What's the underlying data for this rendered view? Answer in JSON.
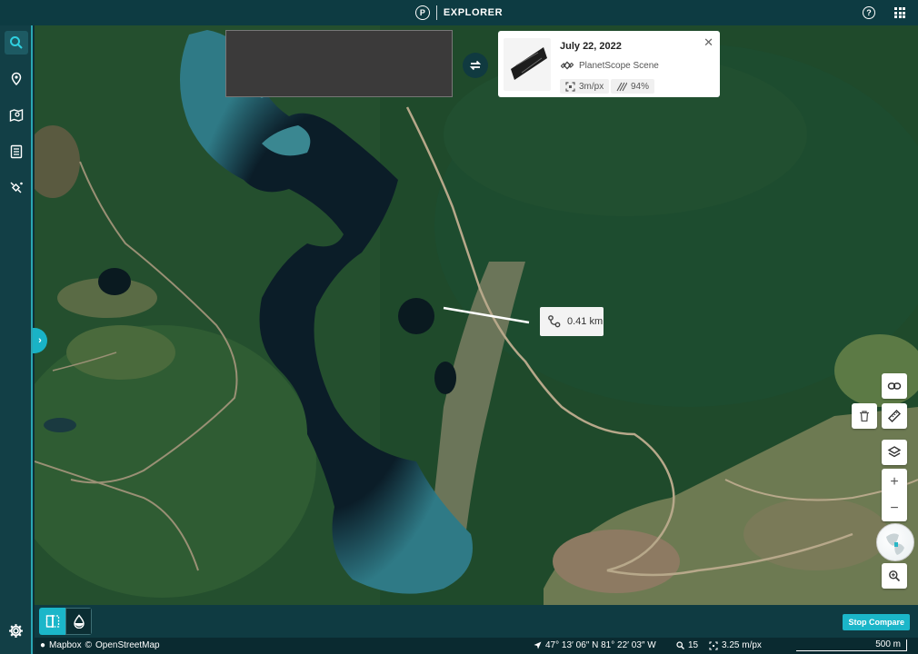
{
  "app": {
    "logo_letter": "P",
    "title": "EXPLORER"
  },
  "sidebar": {
    "items": [
      {
        "icon": "search-icon"
      },
      {
        "icon": "map-pin-icon"
      },
      {
        "icon": "map-image-icon"
      },
      {
        "icon": "list-document-icon"
      },
      {
        "icon": "satellite-task-icon"
      }
    ],
    "settings_icon": "gear-icon"
  },
  "scene_card": {
    "date": "July 22, 2022",
    "type": "PlanetScope Scene",
    "resolution": "3m/px",
    "coverage": "94%"
  },
  "measurement": {
    "distance": "0.41 km"
  },
  "tools": {
    "link_icon": "link-icon",
    "ruler_icon": "ruler-icon",
    "delete_icon": "trash-icon",
    "layers_icon": "layers-icon",
    "zoom_in_label": "+",
    "zoom_out_label": "−",
    "search_zoom_icon": "zoom-search-icon"
  },
  "bottom": {
    "stop_compare": "Stop Compare"
  },
  "status": {
    "attribution_mapbox": "Mapbox",
    "attribution_osm": "OpenStreetMap",
    "coordinates": "47° 13′ 06″ N 81° 22′ 03″ W",
    "zoom": "15",
    "resolution": "3.25 m/px",
    "scale": "500 m"
  },
  "colors": {
    "accent": "#1bb6c9",
    "topbar": "#0d3b42"
  }
}
